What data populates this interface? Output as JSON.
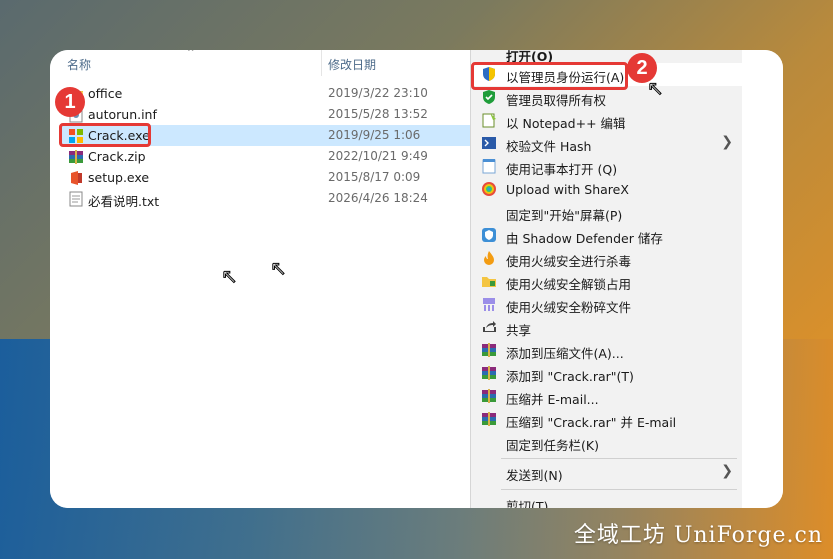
{
  "explorer": {
    "columns": {
      "name": "名称",
      "date": "修改日期"
    },
    "files": [
      {
        "name": "office",
        "date": "2019/3/22 23:10",
        "icon": "folder-icon"
      },
      {
        "name": "autorun.inf",
        "date": "2015/5/28 13:52",
        "icon": "inf-file-icon"
      },
      {
        "name": "Crack.exe",
        "date": "2019/9/25 1:06",
        "icon": "exe-icon"
      },
      {
        "name": "Crack.zip",
        "date": "2022/10/21 9:49",
        "icon": "winrar-icon"
      },
      {
        "name": "setup.exe",
        "date": "2015/8/17 0:09",
        "icon": "office-setup-icon"
      },
      {
        "name": "必看说明.txt",
        "date": "2026/4/26 18:24",
        "icon": "text-file-icon"
      }
    ]
  },
  "badges": {
    "one": "1",
    "two": "2"
  },
  "menu": {
    "items": [
      {
        "label": "打开(O)",
        "icon": ""
      },
      {
        "label": "以管理员身份运行(A)",
        "icon": "uac-shield-icon"
      },
      {
        "label": "管理员取得所有权",
        "icon": "green-shield-icon"
      },
      {
        "label": "以 Notepad++ 编辑",
        "icon": "notepadpp-icon"
      },
      {
        "label": "校验文件 Hash",
        "icon": "powershell-icon"
      },
      {
        "label": "使用记事本打开 (Q)",
        "icon": "notepad-icon"
      },
      {
        "label": "Upload with ShareX",
        "icon": "sharex-icon"
      },
      {
        "label": "固定到\"开始\"屏幕(P)",
        "icon": ""
      },
      {
        "label": "由 Shadow Defender 储存",
        "icon": "shadow-defender-icon"
      },
      {
        "label": "使用火绒安全进行杀毒",
        "icon": "huorong-icon"
      },
      {
        "label": "使用火绒安全解锁占用",
        "icon": "huorong-unlock-icon"
      },
      {
        "label": "使用火绒安全粉碎文件",
        "icon": "huorong-shred-icon"
      },
      {
        "label": "共享",
        "icon": "share-icon"
      },
      {
        "label": "添加到压缩文件(A)...",
        "icon": "winrar-icon"
      },
      {
        "label": "添加到 \"Crack.rar\"(T)",
        "icon": "winrar-icon"
      },
      {
        "label": "压缩并 E-mail...",
        "icon": "winrar-icon"
      },
      {
        "label": "压缩到 \"Crack.rar\" 并 E-mail",
        "icon": "winrar-icon"
      },
      {
        "label": "固定到任务栏(K)",
        "icon": ""
      },
      {
        "label": "发送到(N)",
        "icon": ""
      },
      {
        "label": "剪切(T)",
        "icon": ""
      }
    ]
  },
  "watermark": "全域工坊 UniForge.cn",
  "colors": {
    "highlight": "#e53935",
    "selected_row": "#cce8ff"
  }
}
